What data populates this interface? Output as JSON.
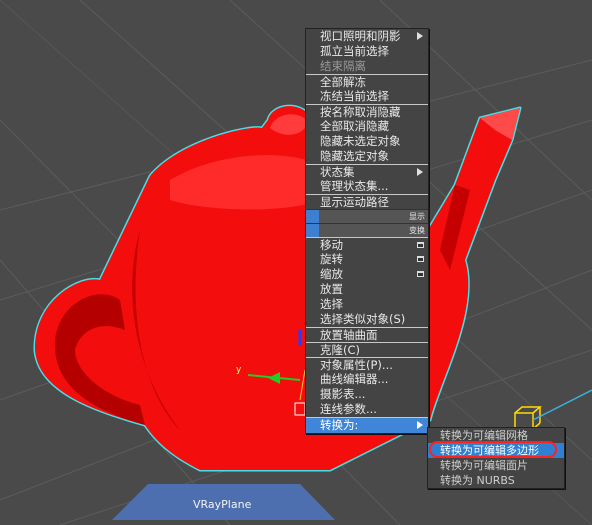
{
  "viewport": {
    "object_label": "VRayPlane",
    "colors": {
      "background": "#4a4a4a",
      "teapot": "#ff0000",
      "selection_outline": "#44e0e8",
      "plane": "#4d6fb0"
    }
  },
  "quad_menu": {
    "items": [
      {
        "label": "视口照明和阴影",
        "submenu": true
      },
      {
        "label": "孤立当前选择"
      },
      {
        "label": "结束隔离",
        "disabled": true
      },
      {
        "label": "全部解冻",
        "sep": true
      },
      {
        "label": "冻结当前选择"
      },
      {
        "label": "按名称取消隐藏",
        "sep": true
      },
      {
        "label": "全部取消隐藏"
      },
      {
        "label": "隐藏未选定对象"
      },
      {
        "label": "隐藏选定对象"
      },
      {
        "label": "状态集",
        "submenu": true,
        "sep": true
      },
      {
        "label": "管理状态集..."
      },
      {
        "label": "显示运动路径",
        "sep": true
      }
    ],
    "header_display": "显示",
    "header_transform": "变换",
    "transform_items": [
      {
        "label": "移动",
        "icon": true
      },
      {
        "label": "旋转",
        "icon": true
      },
      {
        "label": "缩放",
        "icon": true
      },
      {
        "label": "放置"
      },
      {
        "label": "选择"
      },
      {
        "label": "选择类似对象(S)"
      },
      {
        "label": "放置轴曲面",
        "sep": true
      },
      {
        "label": "克隆(C)",
        "sep": true
      },
      {
        "label": "对象属性(P)...",
        "sep": true
      },
      {
        "label": "曲线编辑器..."
      },
      {
        "label": "摄影表..."
      },
      {
        "label": "连线参数..."
      },
      {
        "label": "转换为:",
        "submenu": true,
        "active": true,
        "sep": true
      }
    ]
  },
  "convert_submenu": {
    "items": [
      {
        "label": "转换为可编辑网格"
      },
      {
        "label": "转换为可编辑多边形",
        "highlighted": true
      },
      {
        "label": "转换为可编辑面片"
      },
      {
        "label": "转换为 NURBS"
      }
    ]
  }
}
